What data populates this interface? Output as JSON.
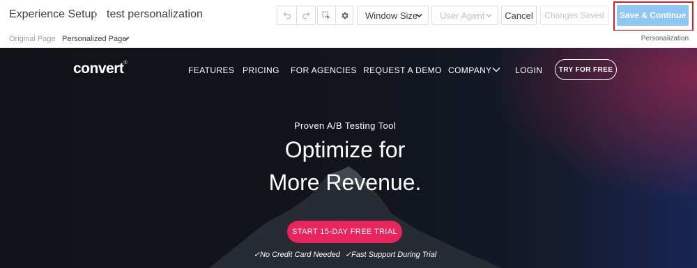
{
  "toolbar": {
    "experience_setup": "Experience Setup",
    "experience_name": "test personalization",
    "window_size": "Window Size",
    "user_agent": "User Agent",
    "cancel": "Cancel",
    "changes_saved": "Changes Saved",
    "save_continue": "Save & Continue",
    "icons": [
      "undo-icon",
      "redo-icon",
      "element-select-icon",
      "gear-icon"
    ],
    "colors": {
      "save_button": "#8ec8f2",
      "highlight_border": "#e01b24"
    }
  },
  "subbar": {
    "original_tab": "Original Page",
    "personalized_tab": "Personalized Page",
    "right_label": "Personalization"
  },
  "site": {
    "logo_text": "convert",
    "logo_mark": "®",
    "nav": {
      "features": "FEATURES",
      "pricing": "PRICING",
      "agencies": "FOR AGENCIES",
      "demo": "REQUEST A DEMO",
      "company": "COMPANY",
      "login": "LOGIN"
    },
    "try_button": "TRY FOR FREE",
    "kicker": "Proven A/B Testing Tool",
    "headline_line1": "Optimize for",
    "headline_line2": "More Revenue.",
    "trial_button": "START 15-DAY FREE TRIAL",
    "check1": "✓No Credit Card Needed",
    "check2": "✓Fast Support During Trial",
    "colors": {
      "trial_button": "#e7255c"
    }
  }
}
